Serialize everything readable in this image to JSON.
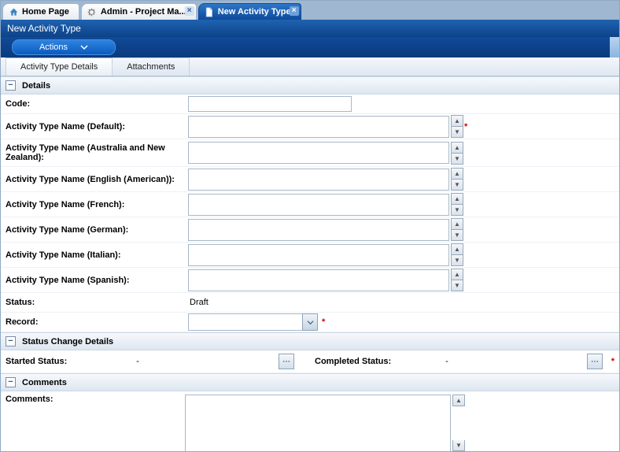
{
  "tabs": [
    {
      "label": "Home Page",
      "icon": "home",
      "closable": false,
      "active": false
    },
    {
      "label": "Admin - Project Ma...",
      "icon": "gear",
      "closable": true,
      "active": false
    },
    {
      "label": "New Activity Type",
      "icon": "file",
      "closable": true,
      "active": true
    }
  ],
  "page_title": "New Activity Type",
  "actions_label": "Actions",
  "subtabs": [
    {
      "label": "Activity Type Details",
      "active": true
    },
    {
      "label": "Attachments",
      "active": false
    }
  ],
  "sections": {
    "details": "Details",
    "status_change": "Status Change Details",
    "comments": "Comments"
  },
  "fields": {
    "code": {
      "label": "Code:",
      "value": ""
    },
    "name_default": {
      "label": "Activity Type Name (Default):",
      "value": "",
      "required": true
    },
    "name_anz": {
      "label": "Activity Type Name (Australia and New Zealand):",
      "value": ""
    },
    "name_en_us": {
      "label": "Activity Type Name (English (American)):",
      "value": ""
    },
    "name_fr": {
      "label": "Activity Type Name (French):",
      "value": ""
    },
    "name_de": {
      "label": "Activity Type Name (German):",
      "value": ""
    },
    "name_it": {
      "label": "Activity Type Name (Italian):",
      "value": ""
    },
    "name_es": {
      "label": "Activity Type Name (Spanish):",
      "value": ""
    },
    "status": {
      "label": "Status:",
      "value": "Draft"
    },
    "record": {
      "label": "Record:",
      "value": "",
      "required": true
    }
  },
  "status_change": {
    "started": {
      "label": "Started Status:",
      "value": "-"
    },
    "completed": {
      "label": "Completed Status:",
      "value": "-",
      "required": true
    }
  },
  "comments": {
    "label": "Comments:",
    "value": ""
  }
}
